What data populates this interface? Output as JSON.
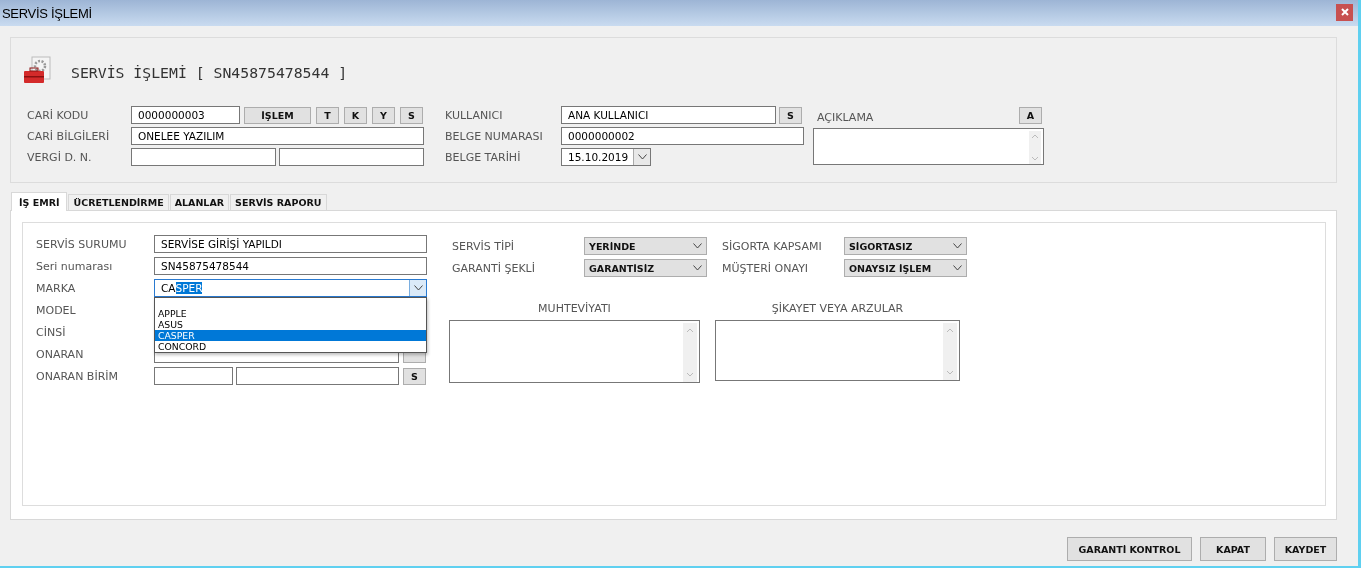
{
  "window": {
    "title": "SERVİS İŞLEMİ"
  },
  "header": {
    "title": "SERVİS İŞLEMİ [ SN45875478544 ]"
  },
  "cari_kodu": {
    "label": "CARİ KODU",
    "value": "0000000003",
    "buttons": [
      "İŞLEM",
      "T",
      "K",
      "Y",
      "S"
    ]
  },
  "cari_bilgileri": {
    "label": "CARİ BİLGİLERİ",
    "value": "ONELEE YAZILIM"
  },
  "vergi": {
    "label": "VERGİ D. N."
  },
  "kullanici": {
    "label": "KULLANICI",
    "value": "ANA KULLANICI",
    "button": "S"
  },
  "belge_numarasi": {
    "label": "BELGE NUMARASI",
    "value": "0000000002"
  },
  "belge_tarihi": {
    "label": "BELGE TARİHİ",
    "value": "15.10.2019"
  },
  "aciklama": {
    "label": "AÇIKLAMA",
    "button": "A"
  },
  "tabs": [
    {
      "label": "İŞ EMRİ",
      "selected": true
    },
    {
      "label": "ÜCRETLENDİRME",
      "selected": false
    },
    {
      "label": "ALANLAR",
      "selected": false
    },
    {
      "label": "SERVİS RAPORU",
      "selected": false
    }
  ],
  "is_emri": {
    "servis_surumu": {
      "label": "SERVİS SURUMU",
      "value": "SERVİSE GİRİŞİ YAPILDI"
    },
    "seri_numarasi": {
      "label": "Seri numarası",
      "value": "SN45875478544"
    },
    "marka": {
      "label": "MARKA",
      "typed": "CA",
      "highlighted": "SPER",
      "open": true,
      "options": [
        {
          "label": "APPLE",
          "selected": false
        },
        {
          "label": "ASUS",
          "selected": false
        },
        {
          "label": "CASPER",
          "selected": true
        },
        {
          "label": "CONCORD",
          "selected": false
        }
      ]
    },
    "model": {
      "label": "MODEL"
    },
    "cinsi": {
      "label": "CİNSİ"
    },
    "onaran": {
      "label": "ONARAN"
    },
    "onaran_birim": {
      "label": "ONARAN BİRİM",
      "button": "S"
    },
    "servis_tipi": {
      "label": "SERVİS TİPİ",
      "value": "YERİNDE"
    },
    "sigorta_kapsami": {
      "label": "SİGORTA KAPSAMI",
      "value": "SİGORTASIZ"
    },
    "garanti_sekli": {
      "label": "GARANTİ ŞEKLİ",
      "value": "GARANTİSİZ"
    },
    "musteri_onayi": {
      "label": "MÜŞTERİ ONAYI",
      "value": "ONAYSIZ İŞLEM"
    },
    "muhteviyati": {
      "label": "MUHTEVİYATI"
    },
    "sikayet": {
      "label": "ŞİKAYET VEYA ARZULAR"
    }
  },
  "buttons": [
    "GARANTİ KONTROL",
    "KAPAT",
    "KAYDET"
  ]
}
